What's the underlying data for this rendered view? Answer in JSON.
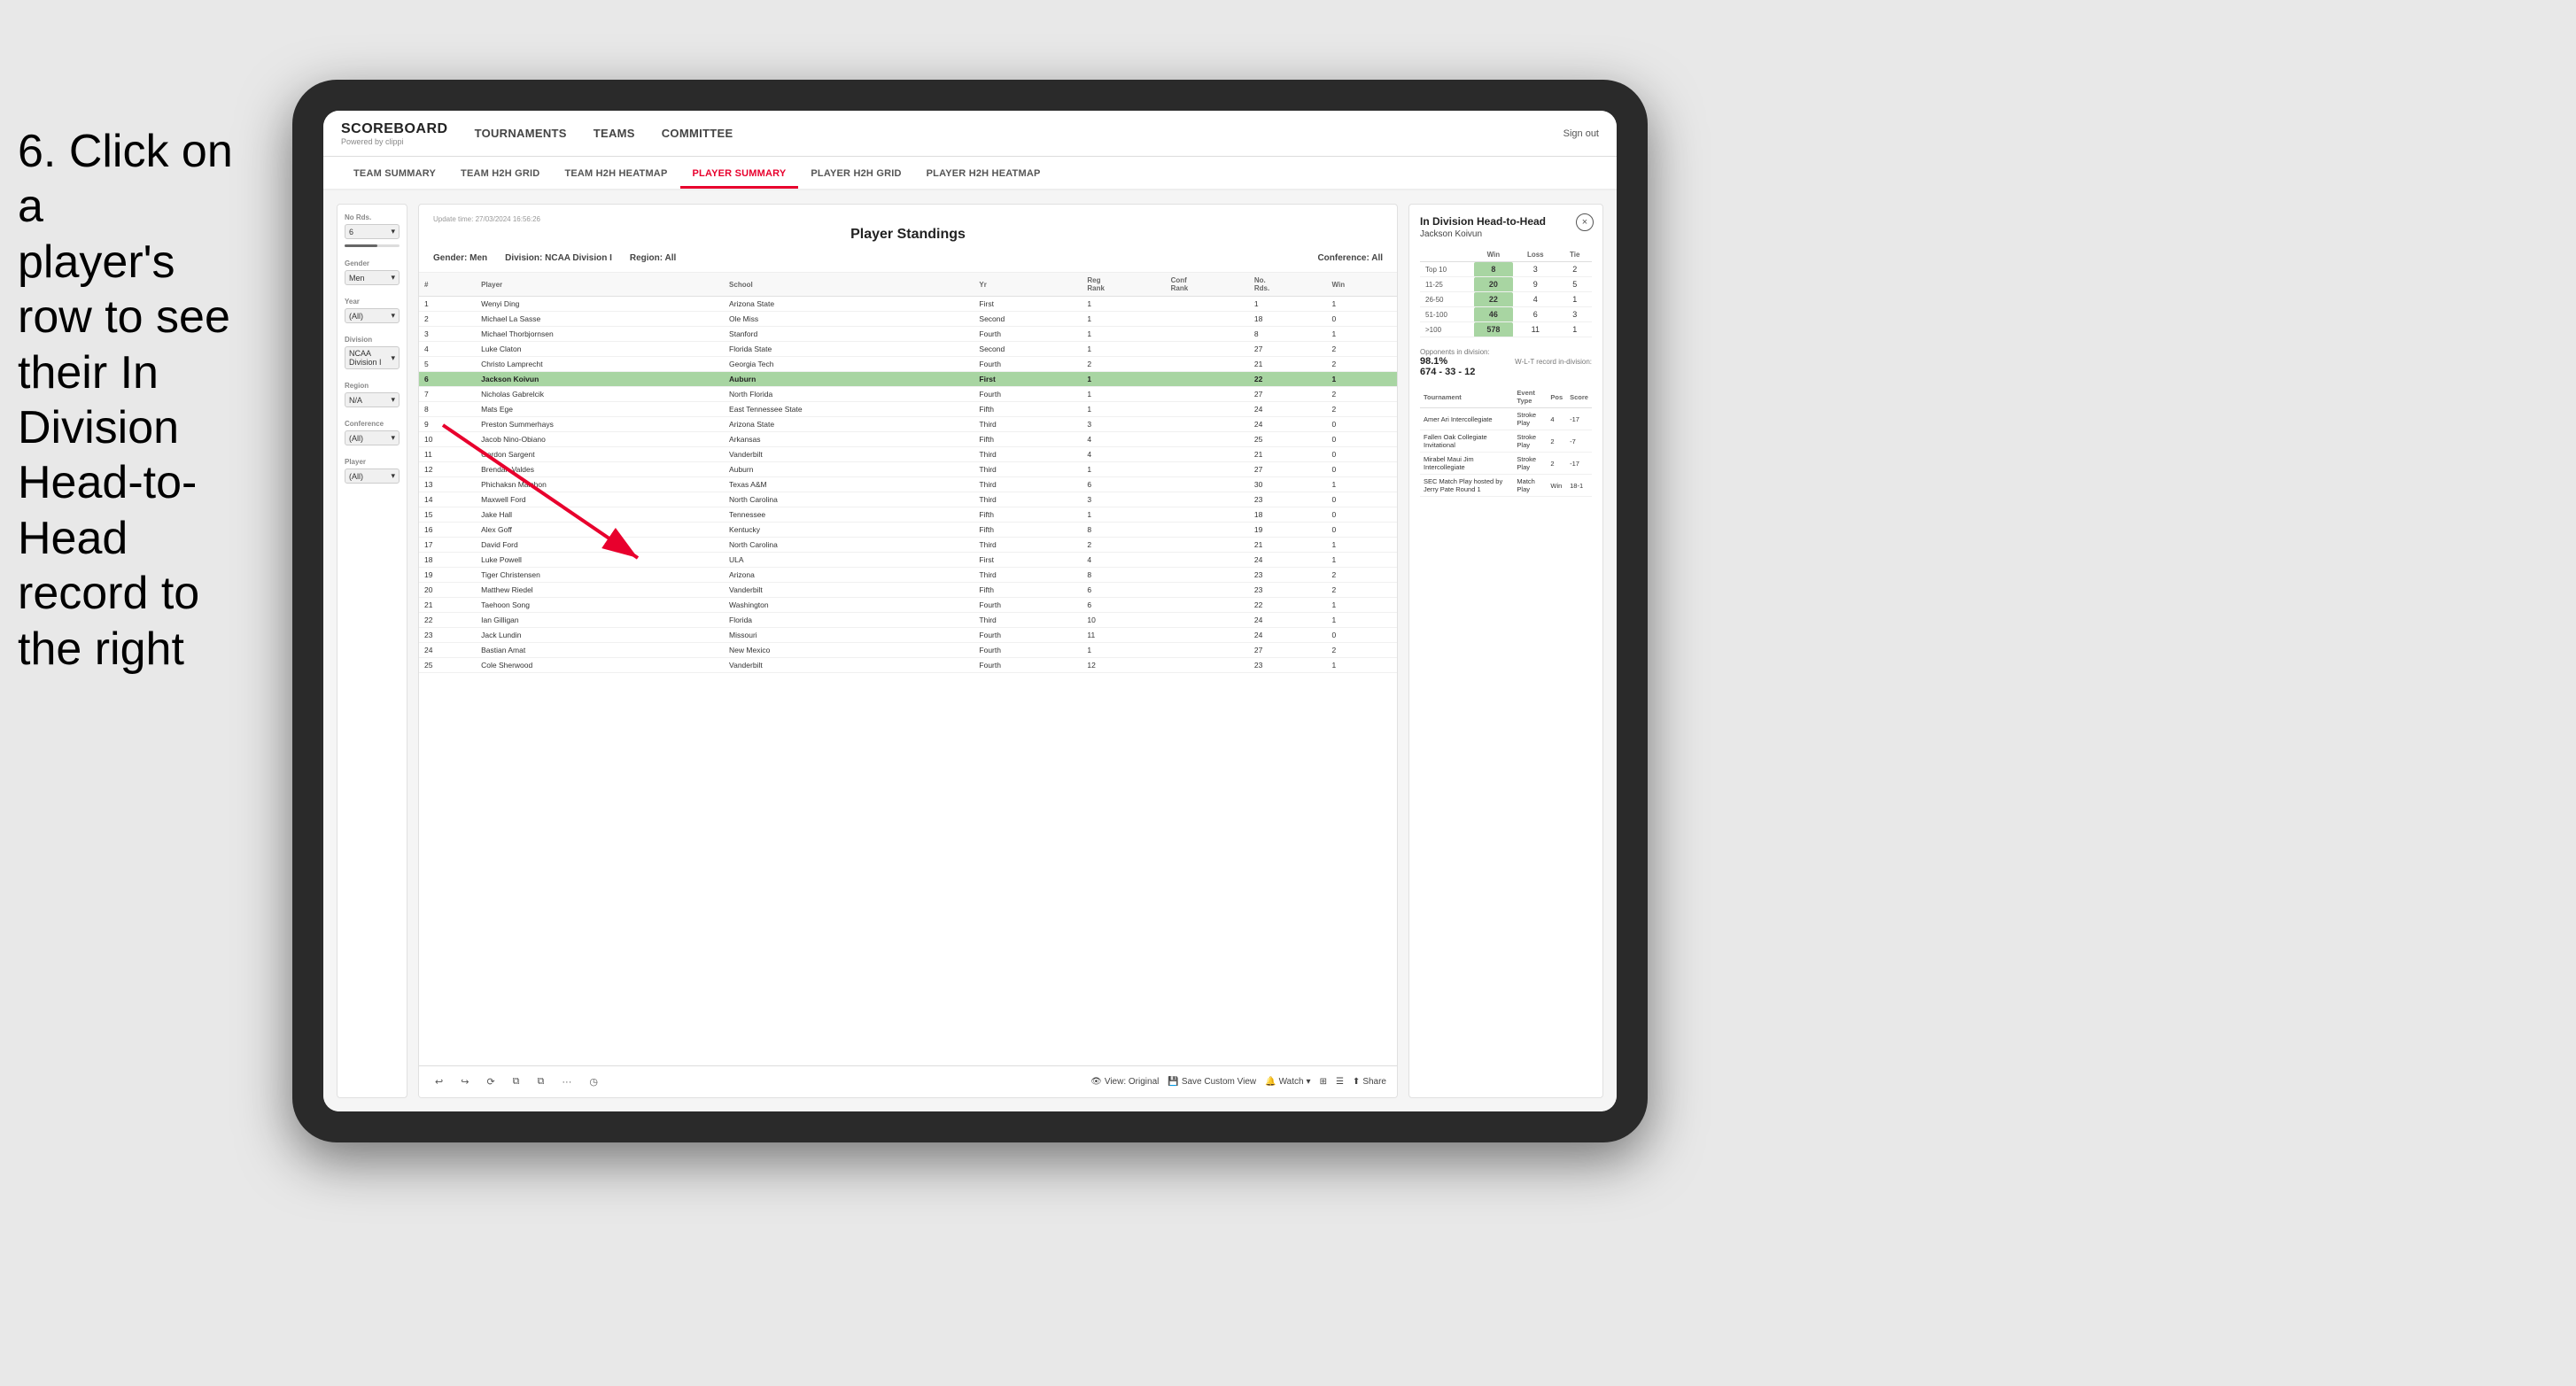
{
  "instruction": {
    "line1": "6. Click on a",
    "line2": "player's row to see",
    "line3": "their In Division",
    "line4": "Head-to-Head",
    "line5": "record to the right"
  },
  "nav": {
    "logo": "SCOREBOARD",
    "logo_sub": "Powered by clippi",
    "items": [
      "TOURNAMENTS",
      "TEAMS",
      "COMMITTEE"
    ],
    "sign_out": "Sign out"
  },
  "sub_nav": {
    "items": [
      "TEAM SUMMARY",
      "TEAM H2H GRID",
      "TEAM H2H HEATMAP",
      "PLAYER SUMMARY",
      "PLAYER H2H GRID",
      "PLAYER H2H HEATMAP"
    ],
    "active": "PLAYER SUMMARY"
  },
  "filters": {
    "no_rds_label": "No Rds.",
    "no_rds_value": "6",
    "gender_label": "Gender",
    "gender_value": "Men",
    "year_label": "Year",
    "year_value": "(All)",
    "division_label": "Division",
    "division_value": "NCAA Division I",
    "region_label": "Region",
    "region_value": "N/A",
    "conference_label": "Conference",
    "conference_value": "(All)",
    "player_label": "Player",
    "player_value": "(All)"
  },
  "panel": {
    "update_time_label": "Update time:",
    "update_time": "27/03/2024 16:56:26",
    "title": "Player Standings",
    "gender_label": "Gender:",
    "gender_value": "Men",
    "division_label": "Division:",
    "division_value": "NCAA Division I",
    "region_label": "Region:",
    "region_value": "All",
    "conference_label": "Conference:",
    "conference_value": "All"
  },
  "table": {
    "headers": [
      "#",
      "Player",
      "School",
      "Yr",
      "Reg Rank",
      "Conf Rank",
      "No. Rds.",
      "Win"
    ],
    "rows": [
      {
        "num": 1,
        "player": "Wenyi Ding",
        "school": "Arizona State",
        "yr": "First",
        "reg": 1,
        "conf": "",
        "rds": 1,
        "win": 1
      },
      {
        "num": 2,
        "player": "Michael La Sasse",
        "school": "Ole Miss",
        "yr": "Second",
        "reg": 1,
        "conf": "",
        "rds": 18,
        "win": 0
      },
      {
        "num": 3,
        "player": "Michael Thorbjornsen",
        "school": "Stanford",
        "yr": "Fourth",
        "reg": 1,
        "conf": "",
        "rds": 8,
        "win": 1
      },
      {
        "num": 4,
        "player": "Luke Claton",
        "school": "Florida State",
        "yr": "Second",
        "reg": 1,
        "conf": "",
        "rds": 27,
        "win": 2
      },
      {
        "num": 5,
        "player": "Christo Lamprecht",
        "school": "Georgia Tech",
        "yr": "Fourth",
        "reg": 2,
        "conf": "",
        "rds": 21,
        "win": 2
      },
      {
        "num": 6,
        "player": "Jackson Koivun",
        "school": "Auburn",
        "yr": "First",
        "reg": 1,
        "conf": "",
        "rds": 22,
        "win": 1,
        "highlighted": true
      },
      {
        "num": 7,
        "player": "Nicholas Gabrelcik",
        "school": "North Florida",
        "yr": "Fourth",
        "reg": 1,
        "conf": "",
        "rds": 27,
        "win": 2
      },
      {
        "num": 8,
        "player": "Mats Ege",
        "school": "East Tennessee State",
        "yr": "Fifth",
        "reg": 1,
        "conf": "",
        "rds": 24,
        "win": 2
      },
      {
        "num": 9,
        "player": "Preston Summerhays",
        "school": "Arizona State",
        "yr": "Third",
        "reg": 3,
        "conf": "",
        "rds": 24,
        "win": 0
      },
      {
        "num": 10,
        "player": "Jacob Nino-Obiano",
        "school": "Arkansas",
        "yr": "Fifth",
        "reg": 4,
        "conf": "",
        "rds": 25,
        "win": 0
      },
      {
        "num": 11,
        "player": "Gordon Sargent",
        "school": "Vanderbilt",
        "yr": "Third",
        "reg": 4,
        "conf": "",
        "rds": 21,
        "win": 0
      },
      {
        "num": 12,
        "player": "Brendan Valdes",
        "school": "Auburn",
        "yr": "Third",
        "reg": 1,
        "conf": "",
        "rds": 27,
        "win": 0
      },
      {
        "num": 13,
        "player": "Phichaksn Maichon",
        "school": "Texas A&M",
        "yr": "Third",
        "reg": 6,
        "conf": "",
        "rds": 30,
        "win": 1
      },
      {
        "num": 14,
        "player": "Maxwell Ford",
        "school": "North Carolina",
        "yr": "Third",
        "reg": 3,
        "conf": "",
        "rds": 23,
        "win": 0
      },
      {
        "num": 15,
        "player": "Jake Hall",
        "school": "Tennessee",
        "yr": "Fifth",
        "reg": 1,
        "conf": "",
        "rds": 18,
        "win": 0
      },
      {
        "num": 16,
        "player": "Alex Goff",
        "school": "Kentucky",
        "yr": "Fifth",
        "reg": 8,
        "conf": "",
        "rds": 19,
        "win": 0
      },
      {
        "num": 17,
        "player": "David Ford",
        "school": "North Carolina",
        "yr": "Third",
        "reg": 2,
        "conf": "",
        "rds": 21,
        "win": 1
      },
      {
        "num": 18,
        "player": "Luke Powell",
        "school": "ULA",
        "yr": "First",
        "reg": 4,
        "conf": "",
        "rds": 24,
        "win": 1
      },
      {
        "num": 19,
        "player": "Tiger Christensen",
        "school": "Arizona",
        "yr": "Third",
        "reg": 8,
        "conf": "",
        "rds": 23,
        "win": 2
      },
      {
        "num": 20,
        "player": "Matthew Riedel",
        "school": "Vanderbilt",
        "yr": "Fifth",
        "reg": 6,
        "conf": "",
        "rds": 23,
        "win": 2
      },
      {
        "num": 21,
        "player": "Taehoon Song",
        "school": "Washington",
        "yr": "Fourth",
        "reg": 6,
        "conf": "",
        "rds": 22,
        "win": 1
      },
      {
        "num": 22,
        "player": "Ian Gilligan",
        "school": "Florida",
        "yr": "Third",
        "reg": 10,
        "conf": "",
        "rds": 24,
        "win": 1
      },
      {
        "num": 23,
        "player": "Jack Lundin",
        "school": "Missouri",
        "yr": "Fourth",
        "reg": 11,
        "conf": "",
        "rds": 24,
        "win": 0
      },
      {
        "num": 24,
        "player": "Bastian Amat",
        "school": "New Mexico",
        "yr": "Fourth",
        "reg": 1,
        "conf": "",
        "rds": 27,
        "win": 2
      },
      {
        "num": 25,
        "player": "Cole Sherwood",
        "school": "Vanderbilt",
        "yr": "Fourth",
        "reg": 12,
        "conf": "",
        "rds": 23,
        "win": 1
      }
    ]
  },
  "toolbar": {
    "view_original": "View: Original",
    "save_custom": "Save Custom View",
    "watch": "Watch",
    "share": "Share"
  },
  "h2h": {
    "title": "In Division Head-to-Head",
    "player": "Jackson Koivun",
    "close_label": "×",
    "table_headers": [
      "",
      "Win",
      "Loss",
      "Tie"
    ],
    "rows": [
      {
        "rank": "Top 10",
        "win": 8,
        "loss": 3,
        "tie": 2,
        "win_highlighted": true
      },
      {
        "rank": "11-25",
        "win": 20,
        "loss": 9,
        "tie": 5,
        "win_highlighted": true
      },
      {
        "rank": "26-50",
        "win": 22,
        "loss": 4,
        "tie": 1,
        "win_highlighted": true
      },
      {
        "rank": "51-100",
        "win": 46,
        "loss": 6,
        "tie": 3,
        "win_highlighted": true
      },
      {
        "rank": ">100",
        "win": 578,
        "loss": 11,
        "tie": 1,
        "win_highlighted": true
      }
    ],
    "opponents_label": "Opponents in division:",
    "opponents_pct": "98.1%",
    "wlt_label": "W-L-T record in-division:",
    "wlt_record": "674 - 33 - 12",
    "tournament_headers": [
      "Tournament",
      "Event Type",
      "Pos",
      "Score"
    ],
    "tournaments": [
      {
        "name": "Amer Ari Intercollegiate",
        "type": "Stroke Play",
        "pos": 4,
        "score": "-17"
      },
      {
        "name": "Fallen Oak Collegiate Invitational",
        "type": "Stroke Play",
        "pos": 2,
        "score": "-7"
      },
      {
        "name": "Mirabel Maui Jim Intercollegiate",
        "type": "Stroke Play",
        "pos": 2,
        "score": "-17"
      },
      {
        "name": "SEC Match Play hosted by Jerry Pate Round 1",
        "type": "Match Play",
        "pos": "Win",
        "score": "18-1"
      }
    ]
  },
  "colors": {
    "accent_red": "#e8002d",
    "highlight_green": "#a8d5a2",
    "win_green": "#7bc47a"
  }
}
